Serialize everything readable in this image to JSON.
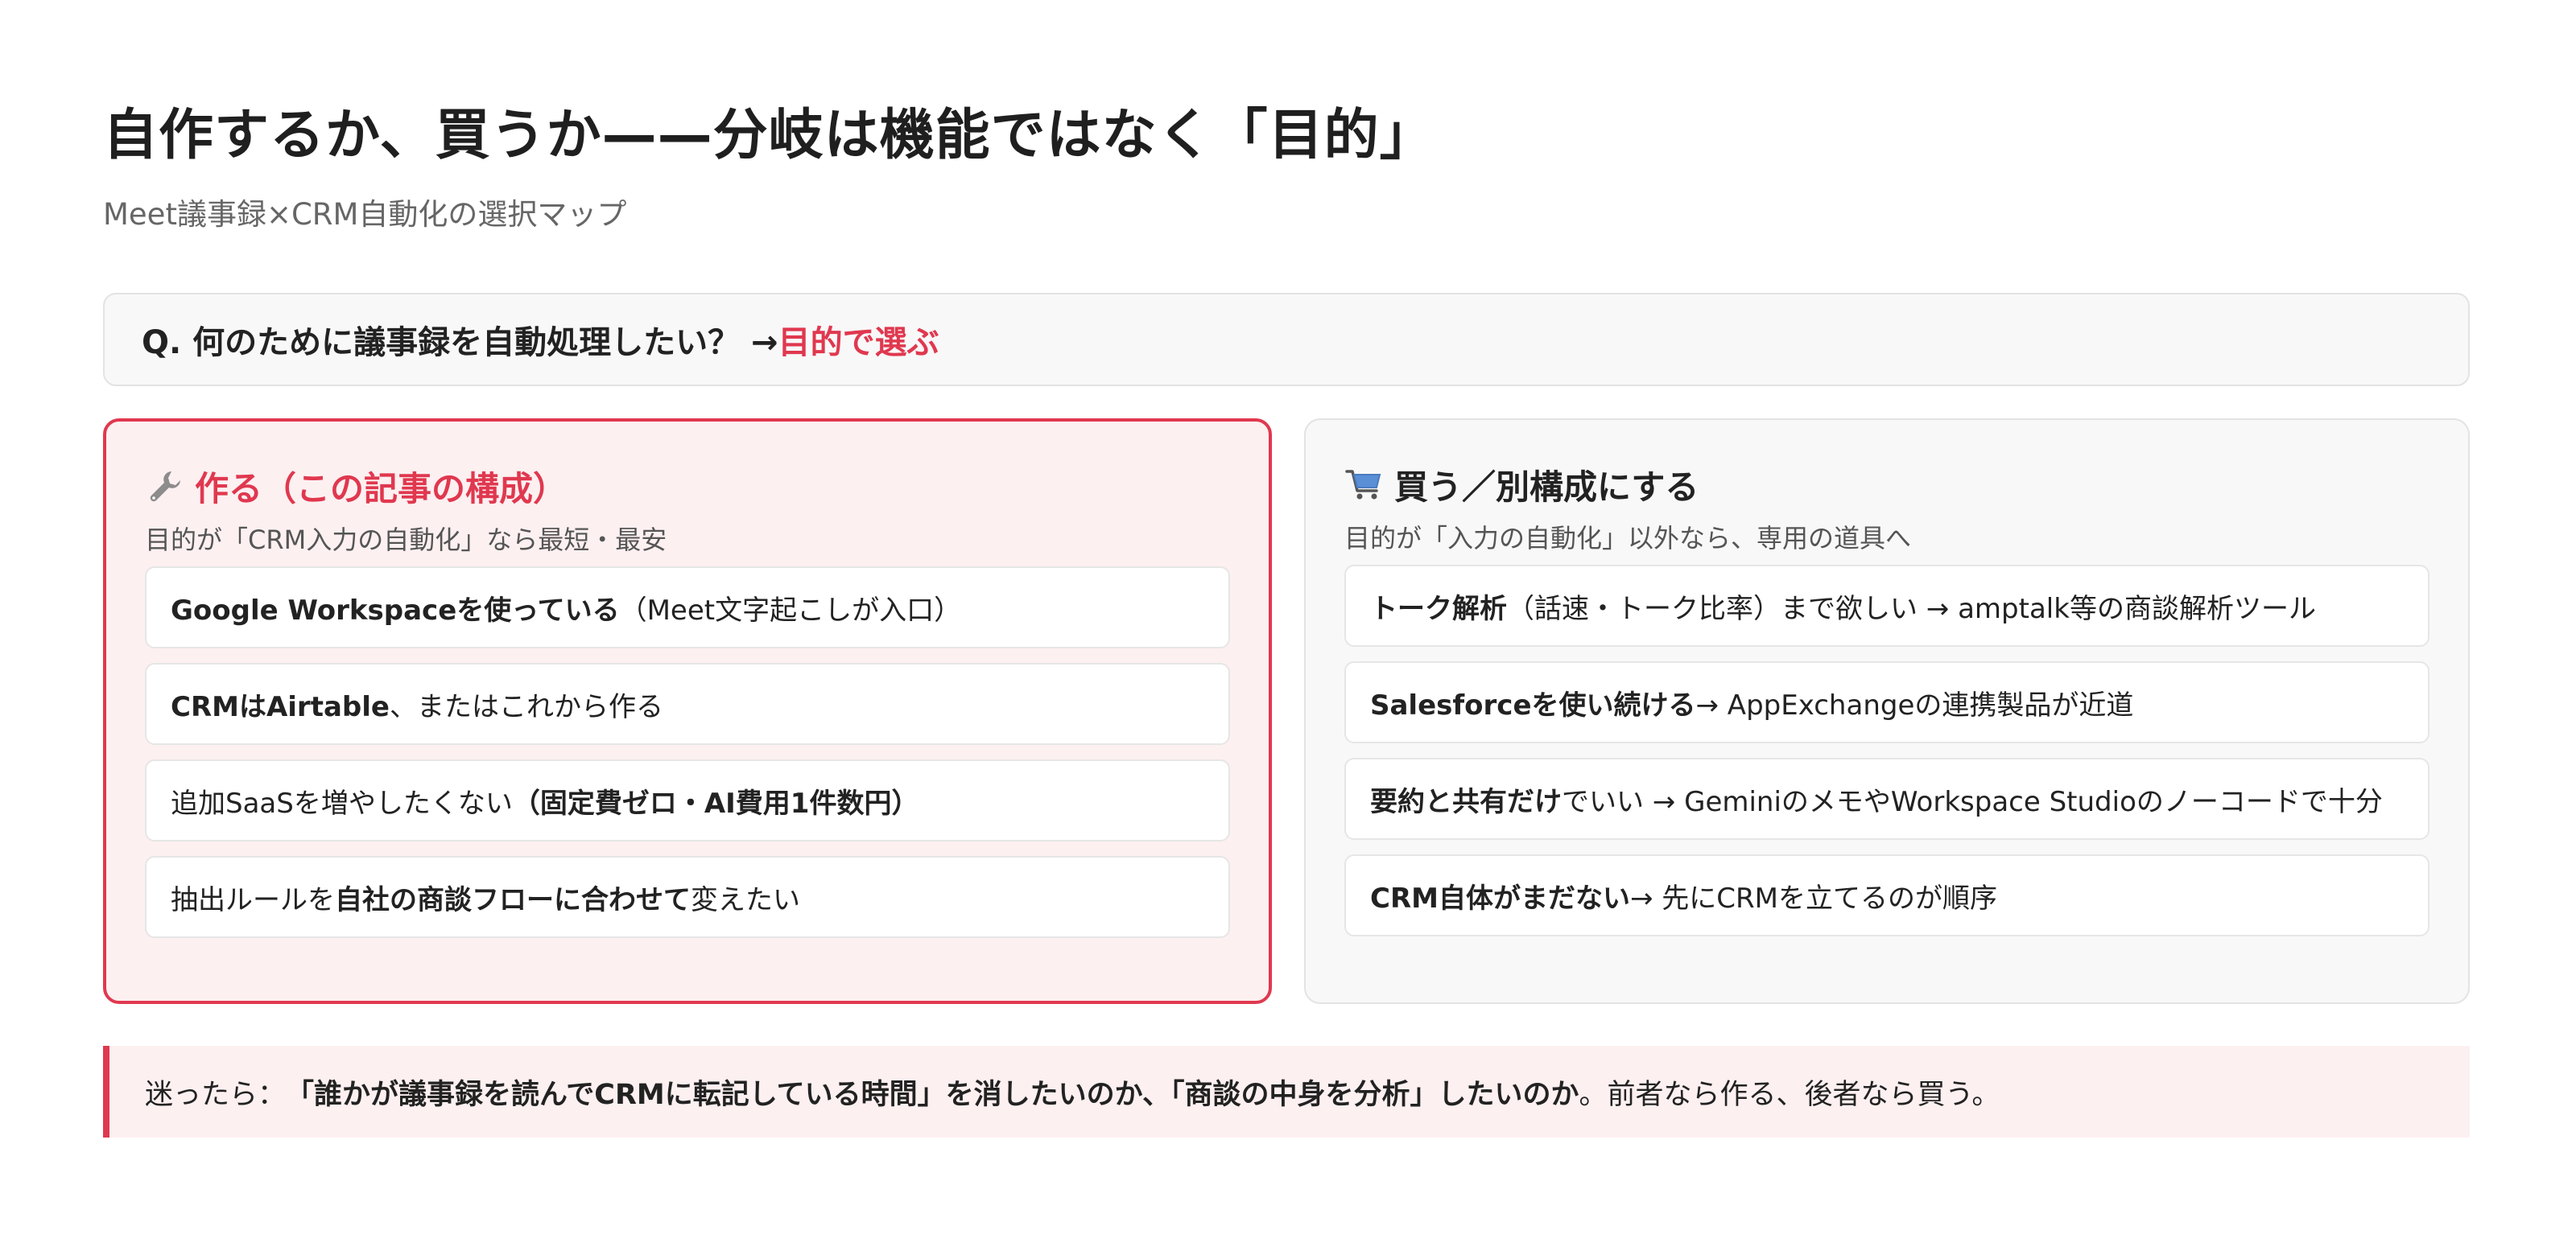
{
  "header": {
    "title": "自作するか、買うか——分岐は機能ではなく「目的」",
    "subtitle": "Meet議事録×CRM自動化の選択マップ"
  },
  "question": {
    "text": "Q. 何のために議事録を自動処理したい？ → ",
    "accent": "目的で選ぶ"
  },
  "make_card": {
    "icon": "wrench-icon",
    "title": "作る（この記事の構成）",
    "description": "目的が「CRM入力の自動化」なら最短・最安",
    "items": [
      {
        "b1": "Google Workspaceを使っている",
        "t1": "（Meet文字起こしが入口）",
        "b2": "",
        "t2": ""
      },
      {
        "b1": "CRMはAirtable",
        "t1": "、またはこれから作る",
        "b2": "",
        "t2": ""
      },
      {
        "b1": "",
        "t1": "追加SaaSを増やしたくない",
        "b2": "（固定費ゼロ・AI費用1件数円）",
        "t2": ""
      },
      {
        "b1": "",
        "t1": "抽出ルールを",
        "b2": "自社の商談フローに合わせて",
        "t2": "変えたい"
      }
    ]
  },
  "buy_card": {
    "icon": "shopping-cart-icon",
    "title": "買う／別構成にする",
    "description": "目的が「入力の自動化」以外なら、専用の道具へ",
    "items": [
      {
        "b1": "トーク解析",
        "t1": "（話速・トーク比率）まで欲しい → amptalk等の商談解析ツール",
        "b2": "",
        "t2": ""
      },
      {
        "b1": "Salesforceを使い続ける",
        "t1": " → AppExchangeの連携製品が近道",
        "b2": "",
        "t2": ""
      },
      {
        "b1": "要約と共有だけ",
        "t1": "でいい → GeminiのメモやWorkspace Studioのノーコードで十分",
        "b2": "",
        "t2": ""
      },
      {
        "b1": "CRM自体がまだない",
        "t1": " → 先にCRMを立てるのが順序",
        "b2": "",
        "t2": ""
      }
    ]
  },
  "tip": {
    "prefix": "迷ったら：",
    "bold": "「誰かが議事録を読んでCRMに転記している時間」を消したいのか、「商談の中身を分析」したいのか",
    "suffix": "。前者なら作る、後者なら買う。"
  },
  "colors": {
    "accent": "#e0384f",
    "accent_bg": "#fdf0f1",
    "neutral_bg": "#f8f8f8"
  }
}
